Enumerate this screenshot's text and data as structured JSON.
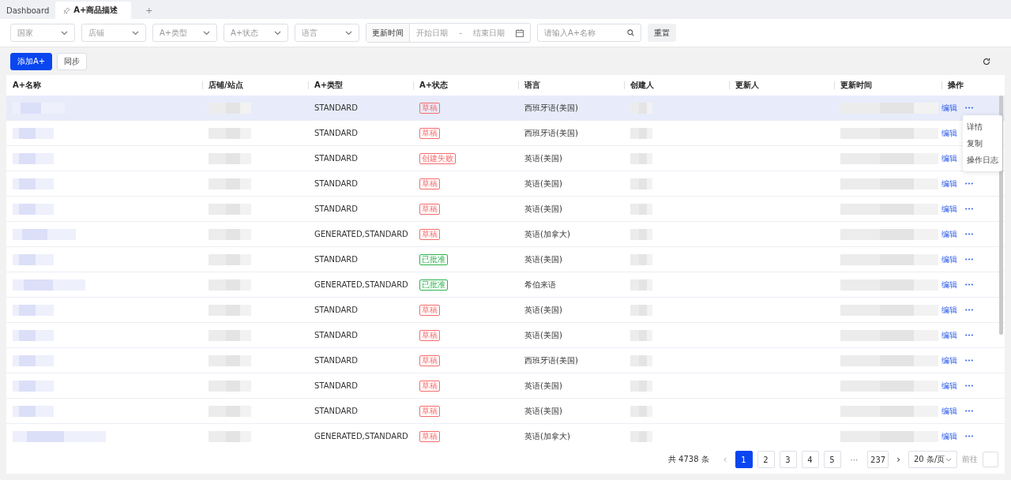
{
  "tabs": [
    {
      "label": "Dashboard",
      "selected": false,
      "pinned": false
    },
    {
      "label": "A+商品描述",
      "selected": true,
      "pinned": true
    }
  ],
  "add_tab": "+",
  "filters": [
    {
      "kind": "select",
      "placeholder": "国家"
    },
    {
      "kind": "select",
      "placeholder": "店铺"
    },
    {
      "kind": "select",
      "placeholder": "A+类型"
    },
    {
      "kind": "select",
      "placeholder": "A+状态"
    },
    {
      "kind": "select",
      "placeholder": "语言"
    },
    {
      "kind": "daterange",
      "label": "更新时间",
      "start_placeholder": "开始日期",
      "separator": "-",
      "end_placeholder": "结束日期"
    },
    {
      "kind": "search",
      "placeholder": "请输入A+名称"
    },
    {
      "kind": "button",
      "label": "重置"
    }
  ],
  "actions": [
    {
      "label": "添加A+",
      "primary": true
    },
    {
      "label": "同步",
      "primary": false
    }
  ],
  "table": {
    "columns": [
      "A+名称",
      "店铺/站点",
      "A+类型",
      "A+状态",
      "语言",
      "创建人",
      "更新人",
      "更新时间",
      "操作"
    ],
    "rows": [
      {
        "type": "STANDARD",
        "status": {
          "label": "草稿",
          "color": "#f56c6c"
        },
        "language": "西班牙语(美国)",
        "edit": "编辑",
        "selected": true
      },
      {
        "type": "STANDARD",
        "status": {
          "label": "草稿",
          "color": "#f56c6c"
        },
        "language": "西班牙语(美国)",
        "edit": "编辑",
        "selected": false
      },
      {
        "type": "STANDARD",
        "status": {
          "label": "创建失败",
          "color": "#f56c6c"
        },
        "language": "英语(美国)",
        "edit": "编辑",
        "selected": false
      },
      {
        "type": "STANDARD",
        "status": {
          "label": "草稿",
          "color": "#f56c6c"
        },
        "language": "英语(美国)",
        "edit": "编辑",
        "selected": false
      },
      {
        "type": "STANDARD",
        "status": {
          "label": "草稿",
          "color": "#f56c6c"
        },
        "language": "英语(美国)",
        "edit": "编辑",
        "selected": false
      },
      {
        "type": "GENERATED,STANDARD",
        "status": {
          "label": "草稿",
          "color": "#f56c6c"
        },
        "language": "英语(加拿大)",
        "edit": "编辑",
        "selected": false
      },
      {
        "type": "STANDARD",
        "status": {
          "label": "已批准",
          "color": "#2bb24c"
        },
        "language": "英语(美国)",
        "edit": "编辑",
        "selected": false
      },
      {
        "type": "GENERATED,STANDARD",
        "status": {
          "label": "已批准",
          "color": "#2bb24c"
        },
        "language": "希伯来语",
        "edit": "编辑",
        "selected": false
      },
      {
        "type": "STANDARD",
        "status": {
          "label": "草稿",
          "color": "#f56c6c"
        },
        "language": "英语(美国)",
        "edit": "编辑",
        "selected": false
      },
      {
        "type": "STANDARD",
        "status": {
          "label": "草稿",
          "color": "#f56c6c"
        },
        "language": "英语(美国)",
        "edit": "编辑",
        "selected": false
      },
      {
        "type": "STANDARD",
        "status": {
          "label": "草稿",
          "color": "#f56c6c"
        },
        "language": "西班牙语(美国)",
        "edit": "编辑",
        "selected": false
      },
      {
        "type": "STANDARD",
        "status": {
          "label": "草稿",
          "color": "#f56c6c"
        },
        "language": "英语(美国)",
        "edit": "编辑",
        "selected": false
      },
      {
        "type": "STANDARD",
        "status": {
          "label": "草稿",
          "color": "#f56c6c"
        },
        "language": "英语(美国)",
        "edit": "编辑",
        "selected": false
      },
      {
        "type": "GENERATED,STANDARD",
        "status": {
          "label": "草稿",
          "color": "#f56c6c"
        },
        "language": "英语(加拿大)",
        "edit": "编辑",
        "selected": false
      }
    ]
  },
  "row_menu": {
    "items": [
      "详情",
      "复制",
      "操作日志"
    ]
  },
  "pagination": {
    "total": "共 4738 条",
    "prev": "‹",
    "pages": [
      {
        "kind": "page",
        "label": "1",
        "selected": true
      },
      {
        "kind": "page",
        "label": "2",
        "selected": false
      },
      {
        "kind": "page",
        "label": "3",
        "selected": false
      },
      {
        "kind": "page",
        "label": "4",
        "selected": false
      },
      {
        "kind": "page",
        "label": "5",
        "selected": false
      },
      {
        "kind": "ellipsis",
        "label": "···",
        "selected": false
      },
      {
        "kind": "page",
        "label": "237",
        "selected": false
      }
    ],
    "next": "›",
    "page_size": "20 条/页",
    "goto_label": "前往"
  }
}
